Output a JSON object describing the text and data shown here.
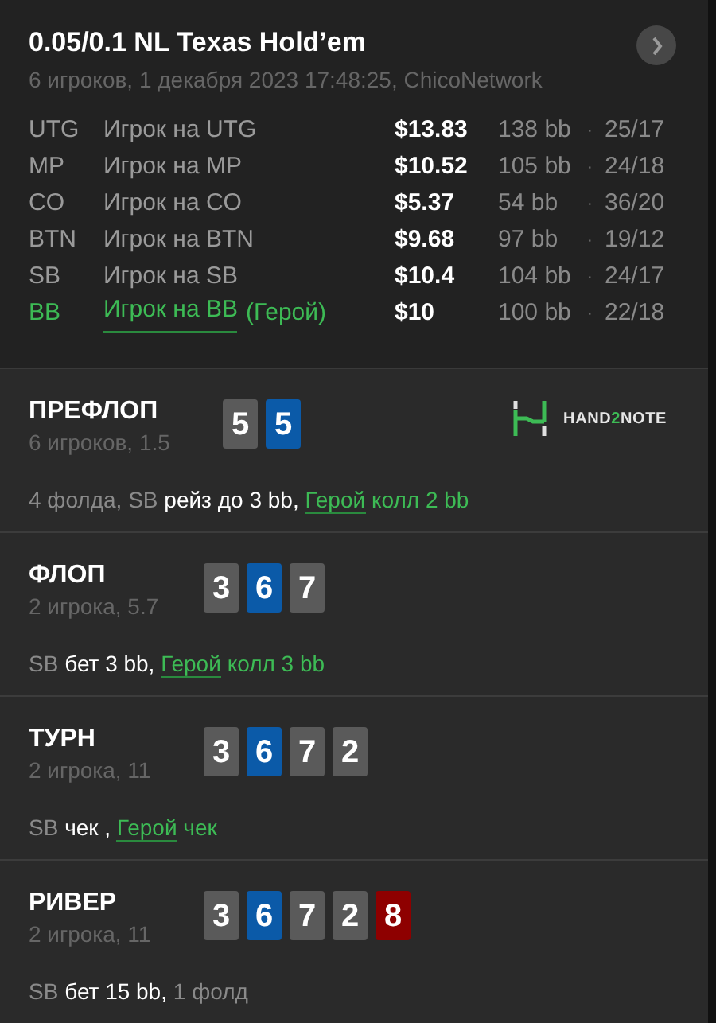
{
  "header": {
    "title": "0.05/0.1 NL Texas Hold’em",
    "subtitle": "6 игроков, 1 декабря 2023 17:48:25, ChicoNetwork"
  },
  "players": [
    {
      "position": "UTG",
      "name": "Игрок на UTG",
      "hero": false,
      "stack": "$13.83",
      "separator": "·",
      "bb": "138 bb",
      "stats": "25/17"
    },
    {
      "position": "MP",
      "name": "Игрок на MP",
      "hero": false,
      "stack": "$10.52",
      "separator": "·",
      "bb": "105 bb",
      "stats": "24/18"
    },
    {
      "position": "CO",
      "name": "Игрок на CO",
      "hero": false,
      "stack": "$5.37",
      "separator": "·",
      "bb": "54 bb",
      "stats": "36/20"
    },
    {
      "position": "BTN",
      "name": "Игрок на BTN",
      "hero": false,
      "stack": "$9.68",
      "separator": "·",
      "bb": "97 bb",
      "stats": "19/12"
    },
    {
      "position": "SB",
      "name": "Игрок на SB",
      "hero": false,
      "stack": "$10.4",
      "separator": "·",
      "bb": "104 bb",
      "stats": "24/17"
    },
    {
      "position": "BB",
      "name": "Игрок на BB",
      "hero": true,
      "hero_label": "(Герой)",
      "stack": "$10",
      "separator": "·",
      "bb": "100 bb",
      "stats": "22/18"
    }
  ],
  "streets": [
    {
      "title": "ПРЕФЛОП",
      "info": "6 игроков, 1.5",
      "cards": [
        {
          "rank": "5",
          "color": "#5a5a5a"
        },
        {
          "rank": "5",
          "color": "#0b5aa8"
        }
      ],
      "logo": [
        {
          "text": "HAND",
          "accent": false
        },
        {
          "text": "2",
          "accent": true
        },
        {
          "text": "NOTE",
          "accent": false
        }
      ],
      "actions": [
        {
          "text": "4 фолда, SB",
          "kind": "muted"
        },
        {
          "text": "рейз до 3 bb,",
          "kind": "action"
        },
        {
          "text": "Герой",
          "kind": "hero"
        },
        {
          "text": "колл 2 bb",
          "kind": "hero_action"
        }
      ]
    },
    {
      "title": "ФЛОП",
      "info": "2 игрока, 5.7",
      "cards": [
        {
          "rank": "3",
          "color": "#5a5a5a"
        },
        {
          "rank": "6",
          "color": "#0b5aa8"
        },
        {
          "rank": "7",
          "color": "#5a5a5a"
        }
      ],
      "actions": [
        {
          "text": "SB",
          "kind": "muted"
        },
        {
          "text": "бет 3 bb,",
          "kind": "action"
        },
        {
          "text": "Герой",
          "kind": "hero"
        },
        {
          "text": "колл 3 bb",
          "kind": "hero_action"
        }
      ]
    },
    {
      "title": "ТУРН",
      "info": "2 игрока, 11",
      "cards": [
        {
          "rank": "3",
          "color": "#5a5a5a"
        },
        {
          "rank": "6",
          "color": "#0b5aa8"
        },
        {
          "rank": "7",
          "color": "#5a5a5a"
        },
        {
          "rank": "2",
          "color": "#5a5a5a"
        }
      ],
      "actions": [
        {
          "text": "SB",
          "kind": "muted"
        },
        {
          "text": "чек ,",
          "kind": "action"
        },
        {
          "text": "Герой",
          "kind": "hero"
        },
        {
          "text": "чек",
          "kind": "hero_action"
        }
      ]
    },
    {
      "title": "РИВЕР",
      "info": "2 игрока, 11",
      "cards": [
        {
          "rank": "3",
          "color": "#5a5a5a"
        },
        {
          "rank": "6",
          "color": "#0b5aa8"
        },
        {
          "rank": "7",
          "color": "#5a5a5a"
        },
        {
          "rank": "2",
          "color": "#5a5a5a"
        },
        {
          "rank": "8",
          "color": "#8e0000"
        }
      ],
      "actions": [
        {
          "text": "SB",
          "kind": "muted"
        },
        {
          "text": "бет 15 bb,",
          "kind": "action"
        },
        {
          "text": "1 фолд",
          "kind": "muted"
        }
      ]
    }
  ]
}
